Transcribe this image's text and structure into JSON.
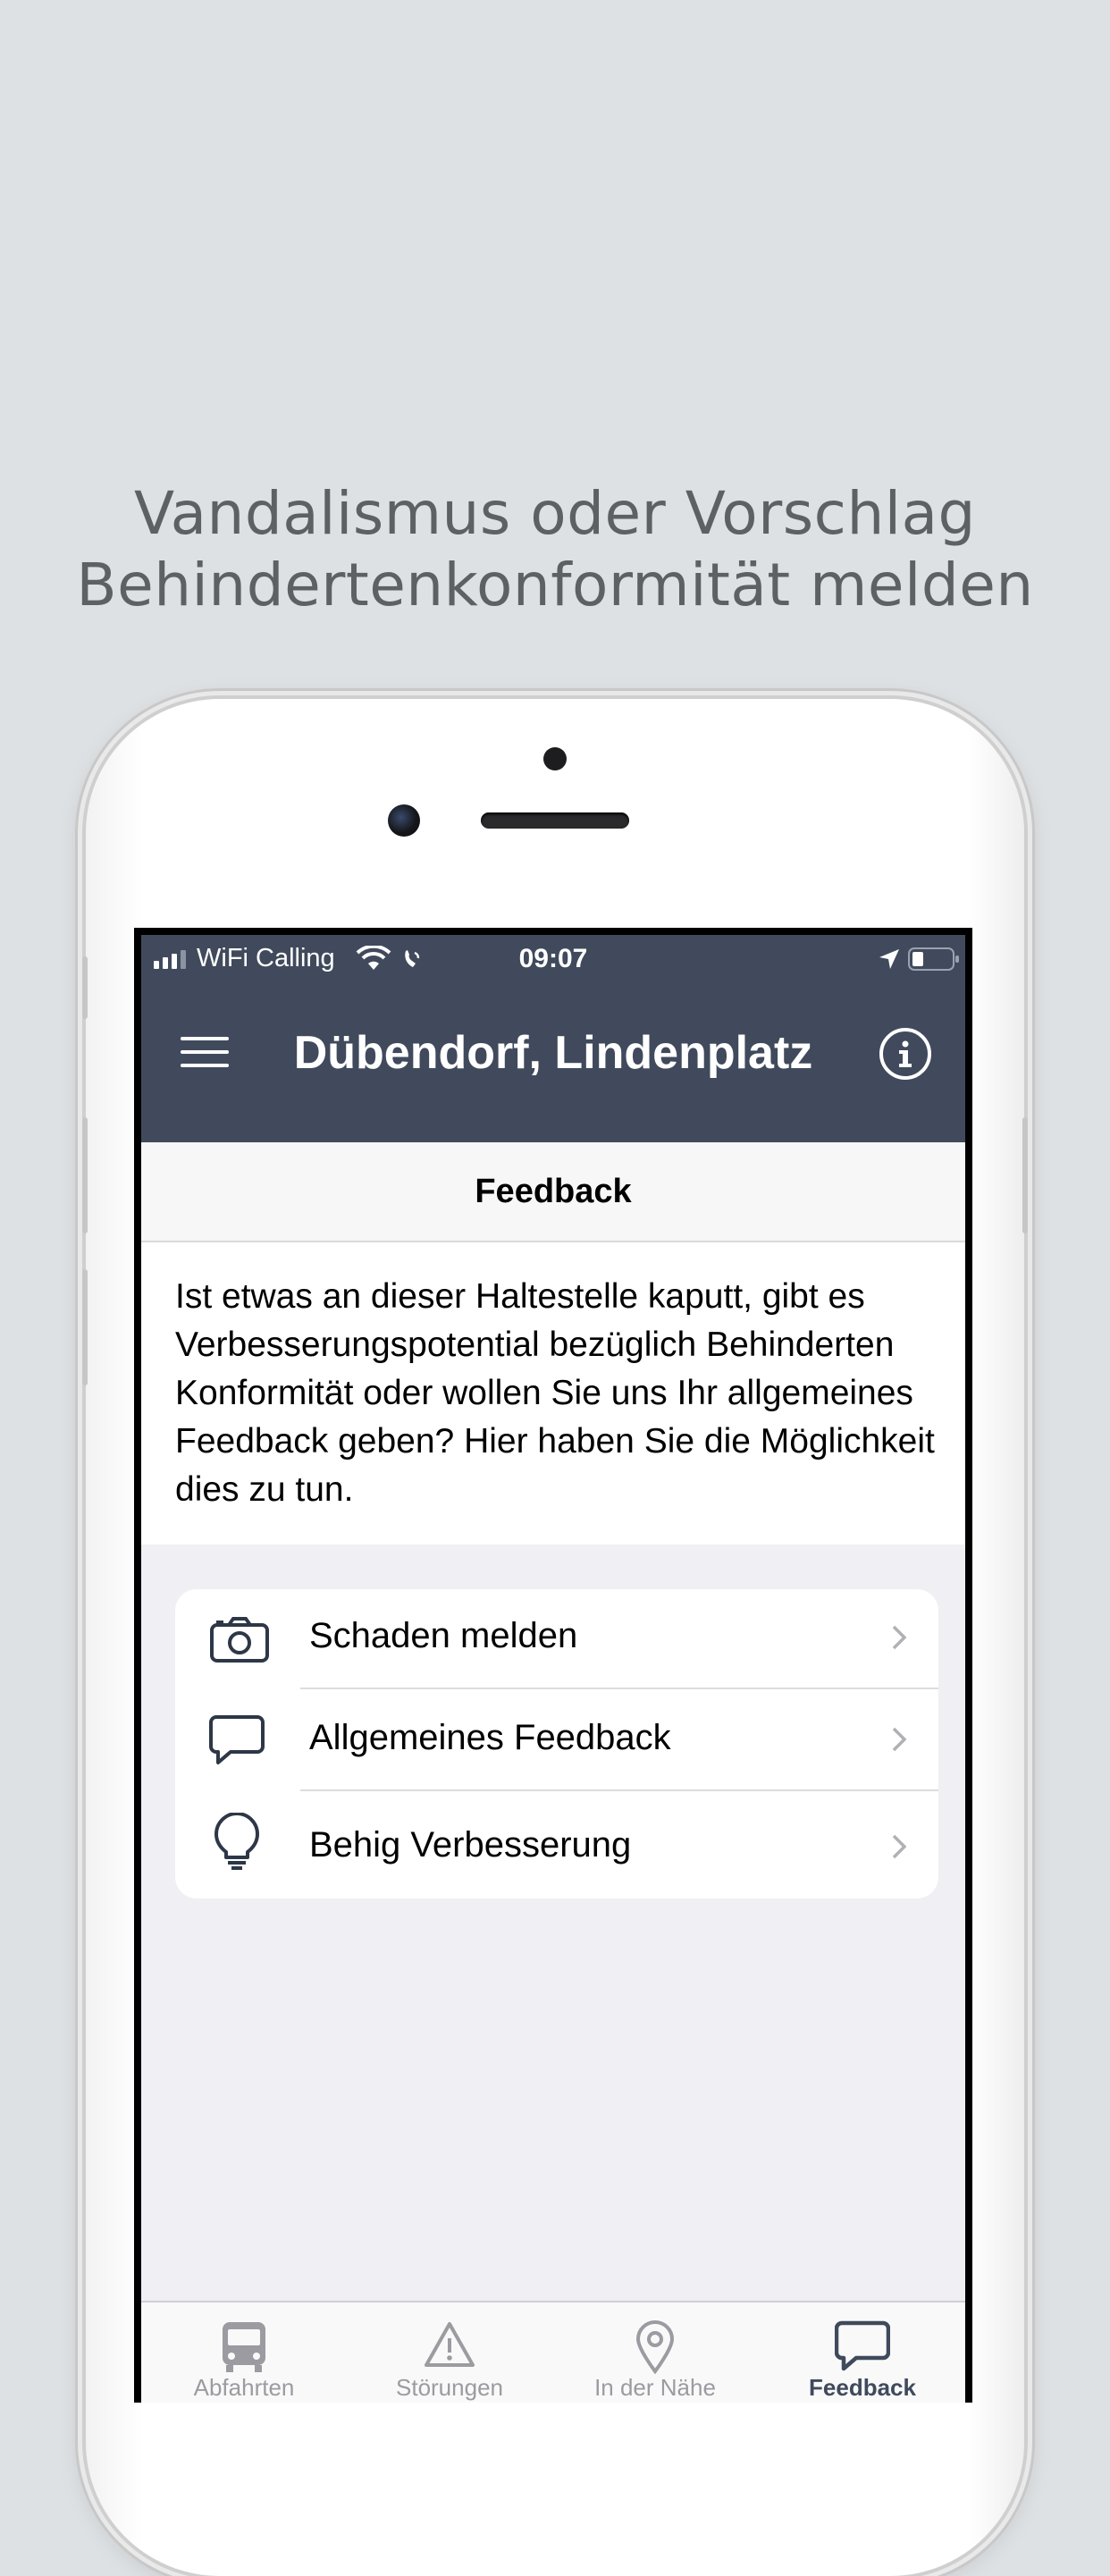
{
  "caption": {
    "line1": "Vandalismus oder Vorschlag",
    "line2": "Behindertenkonformität melden"
  },
  "status_bar": {
    "carrier": "WiFi Calling",
    "time": "09:07"
  },
  "nav_bar": {
    "title": "Dübendorf, Lindenplatz",
    "menu_icon": "hamburger-icon",
    "info_icon": "info-icon"
  },
  "section": {
    "title": "Feedback"
  },
  "intro_text": "Ist etwas an dieser Haltestelle kaputt, gibt es Verbesserungspotential bezüglich Behinderten Konformität oder wollen Sie uns Ihr allgemeines Feedback geben? Hier haben Sie die Möglichkeit dies zu tun.",
  "menu": {
    "items": [
      {
        "label": "Schaden melden",
        "icon": "camera-icon"
      },
      {
        "label": "Allgemeines Feedback",
        "icon": "speech-bubble-icon"
      },
      {
        "label": "Behig Verbesserung",
        "icon": "lightbulb-icon"
      }
    ]
  },
  "tab_bar": {
    "tabs": [
      {
        "label": "Abfahrten",
        "icon": "bus-icon"
      },
      {
        "label": "Störungen",
        "icon": "warning-icon"
      },
      {
        "label": "In der Nähe",
        "icon": "location-pin-icon"
      },
      {
        "label": "Feedback",
        "icon": "speech-bubble-icon",
        "active": true
      }
    ]
  },
  "colors": {
    "background": "#dde1e3",
    "nav_bar": "#404a5c",
    "active_tab": "#404a5c",
    "inactive_tab": "#9b9ba1"
  }
}
